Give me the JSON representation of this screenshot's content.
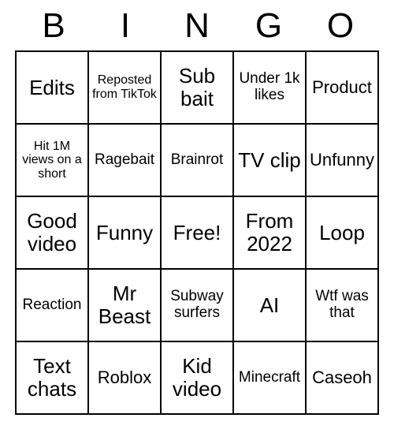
{
  "header": {
    "letters": [
      "B",
      "I",
      "N",
      "G",
      "O"
    ]
  },
  "grid": {
    "rows": [
      [
        {
          "text": "Edits",
          "size": "xl"
        },
        {
          "text": "Reposted from TikTok",
          "size": "s"
        },
        {
          "text": "Sub bait",
          "size": "xl"
        },
        {
          "text": "Under 1k likes",
          "size": "m"
        },
        {
          "text": "Product",
          "size": "l"
        }
      ],
      [
        {
          "text": "Hit 1M views on a short",
          "size": "s"
        },
        {
          "text": "Ragebait",
          "size": "m"
        },
        {
          "text": "Brainrot",
          "size": "m"
        },
        {
          "text": "TV clip",
          "size": "xl"
        },
        {
          "text": "Unfunny",
          "size": "l"
        }
      ],
      [
        {
          "text": "Good video",
          "size": "xl"
        },
        {
          "text": "Funny",
          "size": "xl"
        },
        {
          "text": "Free!",
          "size": "xl"
        },
        {
          "text": "From 2022",
          "size": "xl"
        },
        {
          "text": "Loop",
          "size": "xl"
        }
      ],
      [
        {
          "text": "Reaction",
          "size": "m"
        },
        {
          "text": "Mr Beast",
          "size": "xl"
        },
        {
          "text": "Subway surfers",
          "size": "m"
        },
        {
          "text": "AI",
          "size": "xl"
        },
        {
          "text": "Wtf was that",
          "size": "m"
        }
      ],
      [
        {
          "text": "Text chats",
          "size": "xl"
        },
        {
          "text": "Roblox",
          "size": "l"
        },
        {
          "text": "Kid video",
          "size": "xl"
        },
        {
          "text": "Minecraft",
          "size": "m"
        },
        {
          "text": "Caseoh",
          "size": "l"
        }
      ]
    ]
  }
}
